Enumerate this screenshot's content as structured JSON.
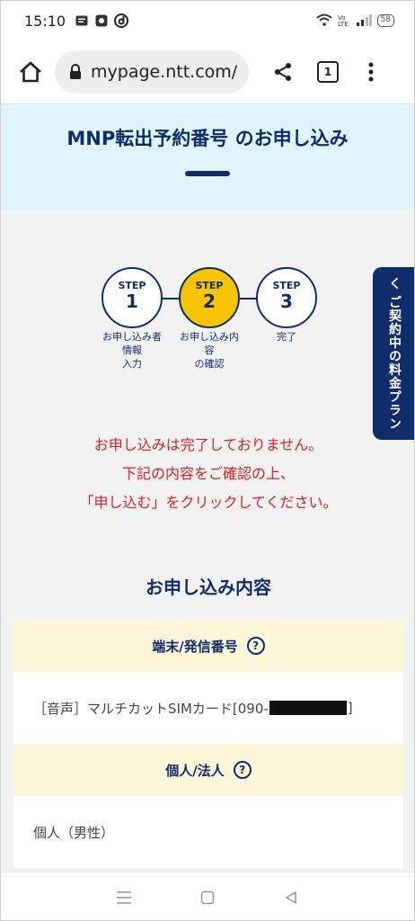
{
  "status": {
    "time": "15:10",
    "battery": "58"
  },
  "browser": {
    "url": "mypage.ntt.com/",
    "tab_count": "1"
  },
  "header": {
    "title": "MNP転出予約番号 のお申し込み"
  },
  "stepper": {
    "steps": [
      {
        "label": "STEP",
        "number": "1",
        "caption": "お申し込み者\n情報\n入力",
        "state": "done"
      },
      {
        "label": "STEP",
        "number": "2",
        "caption": "お申し込み内\n容\nの確認",
        "state": "active"
      },
      {
        "label": "STEP",
        "number": "3",
        "caption": "完了",
        "state": "todo"
      }
    ]
  },
  "side_tab": {
    "label": "く ご契約中の料金プラン"
  },
  "notice": {
    "line1": "お申し込みは完了しておりません。",
    "line2": "下記の内容をご確認の上、",
    "line3": "「申し込む」をクリックしてください。"
  },
  "section": {
    "title": "お申し込み内容",
    "rows": [
      {
        "heading": "端末/発信番号",
        "value_prefix": "［音声］マルチカットSIMカード[090-",
        "value_suffix": "]"
      },
      {
        "heading": "個人/法人",
        "value": "個人（男性）"
      }
    ]
  },
  "colors": {
    "navy": "#0f2d6b",
    "accent": "#f6c500",
    "alert": "#e02020",
    "header_bg": "#dff4fb",
    "row_head_bg": "#fdf5d8"
  }
}
